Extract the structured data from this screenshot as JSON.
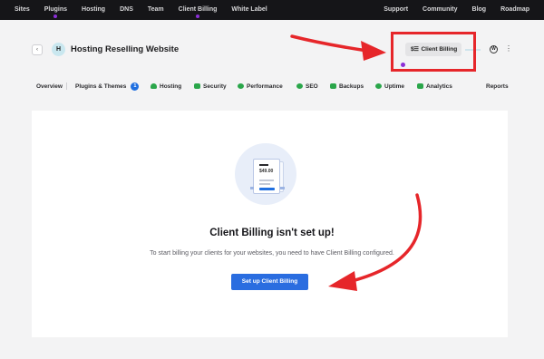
{
  "topnav": {
    "left_items": [
      {
        "label": "Sites",
        "dot": false
      },
      {
        "label": "Plugins",
        "dot": true
      },
      {
        "label": "Hosting",
        "dot": false
      },
      {
        "label": "DNS",
        "dot": false
      },
      {
        "label": "Team",
        "dot": false
      },
      {
        "label": "Client Billing",
        "dot": true
      },
      {
        "label": "White Label",
        "dot": false
      }
    ],
    "right_items": [
      "Support",
      "Community",
      "Blog",
      "Roadmap"
    ],
    "dot_color": "#8b2fd6"
  },
  "site": {
    "back_icon": "‹",
    "avatar_letter": "H",
    "title": "Hosting Reselling Website",
    "client_billing_icon": "$☰",
    "client_billing_label": "Client Billing",
    "wordpress_icon": "W",
    "menu_icon": "⋮"
  },
  "tabs": [
    {
      "label": "Overview",
      "icon": ""
    },
    {
      "label": "Plugins & Themes",
      "badge": "1"
    },
    {
      "label": "Hosting",
      "icon": "cloud-icon"
    },
    {
      "label": "Security",
      "icon": "shield-icon"
    },
    {
      "label": "Performance",
      "icon": "gauge-icon"
    },
    {
      "label": "SEO",
      "icon": "seo-icon"
    },
    {
      "label": "Backups",
      "icon": "backup-icon"
    },
    {
      "label": "Uptime",
      "icon": "uptime-icon"
    },
    {
      "label": "Analytics",
      "icon": "analytics-icon"
    },
    {
      "label": "Reports",
      "icon": ""
    }
  ],
  "empty_state": {
    "illustration_price": "$49.00",
    "title": "Client Billing isn't set up!",
    "description": "To start billing your clients for your websites, you need to have Client Billing configured.",
    "button_label": "Set up Client Billing"
  },
  "colors": {
    "accent": "#2a6de0",
    "annotation_red": "#e6262a",
    "tab_icon_green": "#2aa64a"
  }
}
